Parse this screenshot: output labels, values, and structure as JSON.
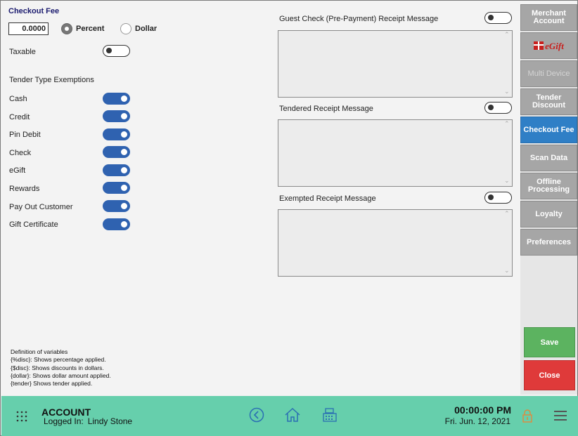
{
  "checkout_fee": {
    "title": "Checkout Fee",
    "amount_value": "0.0000",
    "type_options": [
      {
        "label": "Percent",
        "selected": true
      },
      {
        "label": "Dollar",
        "selected": false
      }
    ],
    "taxable_label": "Taxable",
    "taxable_on": false
  },
  "tender_exemptions": {
    "heading": "Tender Type Exemptions",
    "items": [
      {
        "label": "Cash",
        "on": true
      },
      {
        "label": "Credit",
        "on": true
      },
      {
        "label": "Pin Debit",
        "on": true
      },
      {
        "label": "Check",
        "on": true
      },
      {
        "label": "eGift",
        "on": true
      },
      {
        "label": "Rewards",
        "on": true
      },
      {
        "label": "Pay Out Customer",
        "on": true
      },
      {
        "label": "Gift Certificate",
        "on": true
      }
    ]
  },
  "variables": {
    "heading": "Definition of variables",
    "lines": [
      "{%disc}: Shows percentage applied.",
      "{$disc}:  Shows discounts in dollars.",
      "{dollar}: Shows dollar amount applied.",
      "{tender} Shows tender applied."
    ]
  },
  "messages": [
    {
      "label": "Guest Check (Pre-Payment) Receipt Message",
      "enabled": false,
      "text": ""
    },
    {
      "label": "Tendered Receipt Message",
      "enabled": false,
      "text": ""
    },
    {
      "label": "Exempted Receipt Message",
      "enabled": false,
      "text": ""
    }
  ],
  "nav": {
    "items": [
      {
        "label": "Merchant Account",
        "state": "normal"
      },
      {
        "label": "eGift",
        "state": "logo"
      },
      {
        "label": "Multi Device",
        "state": "disabled"
      },
      {
        "label": "Tender Discount",
        "state": "normal"
      },
      {
        "label": "Checkout Fee",
        "state": "active"
      },
      {
        "label": "Scan Data",
        "state": "normal"
      },
      {
        "label": "Offline Processing",
        "state": "normal"
      },
      {
        "label": "Loyalty",
        "state": "normal"
      },
      {
        "label": "Preferences",
        "state": "normal"
      }
    ],
    "save_label": "Save",
    "close_label": "Close"
  },
  "footer": {
    "section_title": "ACCOUNT",
    "logged_in_label": "Logged In:",
    "user_name": "Lindy Stone",
    "time": "00:00:00 PM",
    "date": "Fri. Jun. 12, 2021",
    "icons": [
      "apps-grid-icon",
      "back-icon",
      "home-icon",
      "register-icon",
      "lock-icon",
      "menu-icon"
    ]
  },
  "colors": {
    "accent_blue": "#2f62b0",
    "active_nav": "#2f7fc6",
    "footer_bg": "#66cfac",
    "save_green": "#5cb360",
    "close_red": "#df3a3a",
    "lock_orange": "#e08a3c"
  }
}
